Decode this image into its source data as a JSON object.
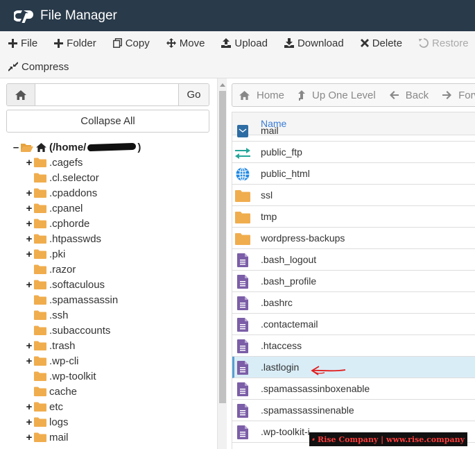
{
  "app": {
    "title": "File Manager"
  },
  "toolbar": {
    "row1": [
      {
        "label": "File",
        "icon": "plus-icon"
      },
      {
        "label": "Folder",
        "icon": "plus-icon"
      },
      {
        "label": "Copy",
        "icon": "copy-icon"
      },
      {
        "label": "Move",
        "icon": "move-icon"
      },
      {
        "label": "Upload",
        "icon": "upload-icon"
      },
      {
        "label": "Download",
        "icon": "download-icon"
      },
      {
        "label": "Delete",
        "icon": "times-icon"
      },
      {
        "label": "Restore",
        "icon": "undo-icon",
        "disabled": true
      }
    ],
    "row2": [
      {
        "label": "Compress",
        "icon": "compress-icon"
      }
    ]
  },
  "left": {
    "search": {
      "value": "",
      "go_label": "Go"
    },
    "collapse_label": "Collapse All",
    "tree": {
      "root_label_prefix": "(/home/",
      "root_label_suffix": ")",
      "items": [
        {
          "label": ".cagefs",
          "expandable": true
        },
        {
          "label": ".cl.selector",
          "expandable": false
        },
        {
          "label": ".cpaddons",
          "expandable": true
        },
        {
          "label": ".cpanel",
          "expandable": true
        },
        {
          "label": ".cphorde",
          "expandable": true
        },
        {
          "label": ".htpasswds",
          "expandable": true
        },
        {
          "label": ".pki",
          "expandable": true
        },
        {
          "label": ".razor",
          "expandable": false
        },
        {
          "label": ".softaculous",
          "expandable": true
        },
        {
          "label": ".spamassassin",
          "expandable": false
        },
        {
          "label": ".ssh",
          "expandable": false
        },
        {
          "label": ".subaccounts",
          "expandable": false
        },
        {
          "label": ".trash",
          "expandable": true
        },
        {
          "label": ".wp-cli",
          "expandable": true
        },
        {
          "label": ".wp-toolkit",
          "expandable": false
        },
        {
          "label": "cache",
          "expandable": false
        },
        {
          "label": "etc",
          "expandable": true
        },
        {
          "label": "logs",
          "expandable": true
        },
        {
          "label": "mail",
          "expandable": true
        }
      ]
    }
  },
  "right": {
    "nav": [
      {
        "label": "Home",
        "icon": "home-icon"
      },
      {
        "label": "Up One Level",
        "icon": "level-up-icon"
      },
      {
        "label": "Back",
        "icon": "arrow-left-icon"
      },
      {
        "label": "Forwa",
        "icon": "arrow-right-icon"
      }
    ],
    "column_name": "Name",
    "rows": [
      {
        "name": "mail",
        "type": "mail-folder",
        "partial": true
      },
      {
        "name": "public_ftp",
        "type": "ftp"
      },
      {
        "name": "public_html",
        "type": "globe"
      },
      {
        "name": "ssl",
        "type": "folder"
      },
      {
        "name": "tmp",
        "type": "folder"
      },
      {
        "name": "wordpress-backups",
        "type": "folder"
      },
      {
        "name": ".bash_logout",
        "type": "file"
      },
      {
        "name": ".bash_profile",
        "type": "file"
      },
      {
        "name": ".bashrc",
        "type": "file"
      },
      {
        "name": ".contactemail",
        "type": "file"
      },
      {
        "name": ".htaccess",
        "type": "file"
      },
      {
        "name": ".lastlogin",
        "type": "file",
        "selected": true
      },
      {
        "name": ".spamassassinboxenable",
        "type": "file"
      },
      {
        "name": ".spamassassinenable",
        "type": "file"
      },
      {
        "name": ".wp-toolkit-i",
        "type": "file"
      }
    ]
  },
  "watermark": {
    "text": "Rise Company | www.rise.company"
  },
  "colors": {
    "header_bg": "#293a4a",
    "folder": "#f0ad4e",
    "file": "#7b5ea7",
    "link": "#3a7bd5",
    "selected_row": "#d9edf7"
  }
}
